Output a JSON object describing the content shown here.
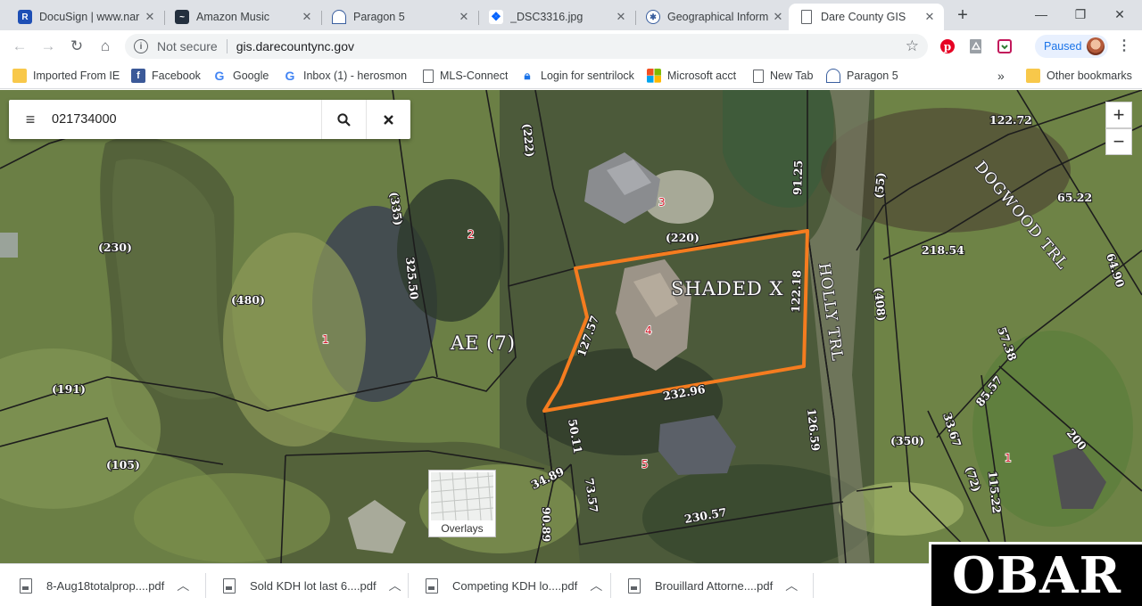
{
  "browser": {
    "tabs": [
      {
        "title": "DocuSign | www.nar",
        "icon": "docusign-icon",
        "color": "#1e4fb5"
      },
      {
        "title": "Amazon Music",
        "icon": "amazon-music-icon",
        "color": "#232f3e"
      },
      {
        "title": "Paragon 5",
        "icon": "paragon-icon",
        "color": "#3a5f9f"
      },
      {
        "title": "_DSC3316.jpg",
        "icon": "dropbox-icon",
        "color": "#0061fe"
      },
      {
        "title": "Geographical Inform",
        "icon": "globe-icon",
        "color": "#3a5f9f"
      },
      {
        "title": "Dare County GIS",
        "icon": "page-icon",
        "color": "#5f6368"
      }
    ],
    "address": {
      "security": "Not secure",
      "url": "gis.darecountync.gov"
    },
    "profile_label": "Paused",
    "bookmarks": [
      {
        "label": "Imported From IE",
        "icon": "folder-icon"
      },
      {
        "label": "Facebook",
        "icon": "facebook-icon"
      },
      {
        "label": "Google",
        "icon": "google-icon"
      },
      {
        "label": "Inbox (1) - herosmon",
        "icon": "google-icon"
      },
      {
        "label": "MLS-Connect",
        "icon": "page-icon"
      },
      {
        "label": "Login for sentrilock",
        "icon": "lock-icon"
      },
      {
        "label": "Microsoft acct",
        "icon": "microsoft-icon"
      },
      {
        "label": "New Tab",
        "icon": "page-icon"
      },
      {
        "label": "Paragon 5",
        "icon": "paragon-icon"
      }
    ],
    "bookmarks_overflow": "»",
    "other_bookmarks": "Other bookmarks"
  },
  "map": {
    "search_value": "021734000",
    "zoom_in": "+",
    "zoom_out": "−",
    "overlays_label": "Overlays",
    "labels": {
      "l230": "(230)",
      "l480": "(480)",
      "l191": "(191)",
      "l105": "(105)",
      "l335": "(335)",
      "l222": "(222)",
      "l32550": "325.50",
      "l220": "(220)",
      "l9125": "91.25",
      "l12272": "122.72",
      "l6522": "65.22",
      "l6490": "64.90",
      "l55": "(55)",
      "l21854": "218.54",
      "l408": "(408)",
      "l5738": "57.38",
      "l8557": "85.57",
      "l3367": "33.67",
      "l350": "(350)",
      "l200": "200",
      "l72": "(72)",
      "l11522": "115.22",
      "l12218": "122.18",
      "l12757": "127.57",
      "l23296": "232.96",
      "l12659": "126.59",
      "l5011": "50.11",
      "l3489": "34.89",
      "l7357": "73.57",
      "l9089": "90.89",
      "l23057": "230.57"
    },
    "parcel_numbers": {
      "p1a": "1",
      "p2": "2",
      "p3": "3",
      "p4": "4",
      "p5": "5",
      "p1b": "1"
    },
    "subdivision_label": "AE (7)",
    "shaded_label": "SHADED X",
    "streets": {
      "holly": "HOLLY TRL",
      "dogwood": "DOGWOOD TRL"
    },
    "highlight_color": "#f57c1f"
  },
  "downloads": [
    {
      "name": "8-Aug18totalprop....pdf"
    },
    {
      "name": "Sold KDH lot last 6....pdf"
    },
    {
      "name": "Competing KDH lo....pdf"
    },
    {
      "name": "Brouillard Attorne....pdf"
    }
  ],
  "watermark": "OBAR"
}
